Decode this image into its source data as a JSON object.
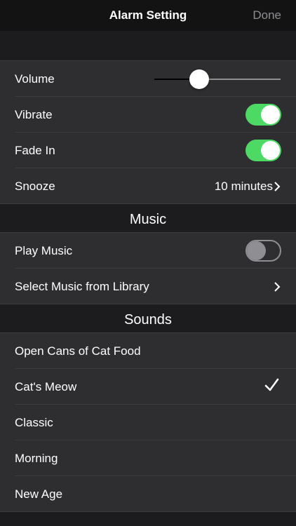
{
  "nav": {
    "title": "Alarm Setting",
    "done_label": "Done"
  },
  "settings": {
    "volume": {
      "label": "Volume",
      "value": 0.33
    },
    "vibrate": {
      "label": "Vibrate",
      "on": true
    },
    "fade_in": {
      "label": "Fade In",
      "on": true
    },
    "snooze": {
      "label": "Snooze",
      "value": "10 minutes"
    }
  },
  "music": {
    "header": "Music",
    "play_music": {
      "label": "Play Music",
      "on": false
    },
    "select_library": {
      "label": "Select Music from Library"
    }
  },
  "sounds": {
    "header": "Sounds",
    "items": [
      {
        "label": "Open Cans of Cat Food",
        "selected": false
      },
      {
        "label": "Cat's Meow",
        "selected": true
      },
      {
        "label": "Classic",
        "selected": false
      },
      {
        "label": "Morning",
        "selected": false
      },
      {
        "label": "New Age",
        "selected": false
      }
    ]
  },
  "colors": {
    "accent_on": "#4cd964",
    "background": "#1c1c1e",
    "cell": "#2e2e30"
  }
}
